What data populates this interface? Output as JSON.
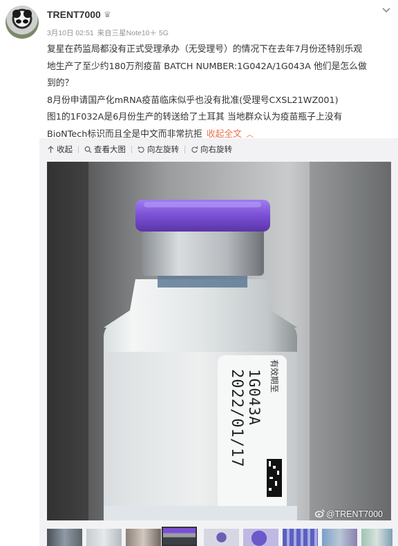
{
  "post": {
    "username": "TRENT7000",
    "badge_icon": "crown-icon",
    "date": "3月10日 02:51",
    "source": "来自三星Note10＋ 5G",
    "lines": [
      "复星在药监局都没有正式受理承办（无受理号）的情况下在去年7月份还特别乐观",
      "地生产了至少约180万剂疫苗 BATCH NUMBER:1G042A/1G043A 他们是怎么做",
      "到的？",
      "8月份申请国产化mRNA疫苗临床似乎也没有批准(受理号CXSL21WZ001)",
      "图1的1F032A是6月份生产的转送给了土耳其 当地群众认为疫苗瓶子上没有"
    ],
    "last_line": "BioNTech标识而且全是中文而非常抗拒",
    "collapse_label": "收起全文",
    "collapse_icon": "chevron-up-icon"
  },
  "toolbar": {
    "collapse": "收起",
    "view_large": "查看大图",
    "rotate_left": "向左旋转",
    "rotate_right": "向右旋转"
  },
  "photo": {
    "label_line1": "有效期至",
    "batch": "1G043A",
    "expiry": "2022/01/17",
    "watermark": "@TRENT7000",
    "cap_color": "#7b4fd4"
  },
  "thumbnails": {
    "count": 9,
    "active_index": 3
  },
  "colors": {
    "link": "#eb7350",
    "panel_bg": "#f2f2f5"
  }
}
